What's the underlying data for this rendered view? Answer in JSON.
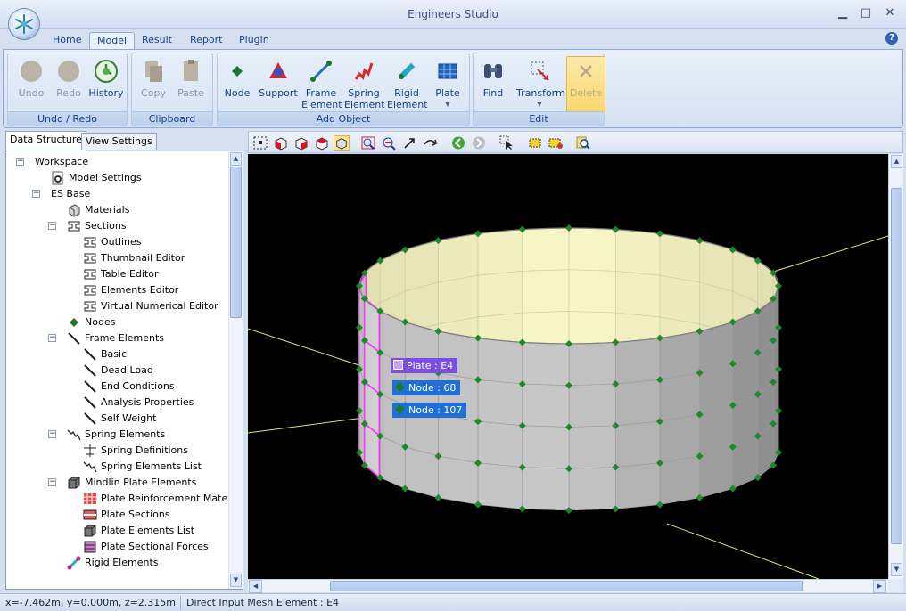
{
  "window": {
    "title": "Engineers Studio",
    "controls": {
      "minimize": "▁",
      "maximize": "□",
      "close": "✕"
    }
  },
  "ribbon": {
    "tabs": [
      "Home",
      "Model",
      "Result",
      "Report",
      "Plugin"
    ],
    "active_tab": "Model",
    "help": "?",
    "groups": [
      {
        "label": "Undo / Redo",
        "buttons": [
          "Undo",
          "Redo",
          "History"
        ]
      },
      {
        "label": "Clipboard",
        "buttons": [
          "Copy",
          "Paste"
        ]
      },
      {
        "label": "Add Object",
        "buttons": [
          "Node",
          "Support",
          "Frame\nElement",
          "Spring\nElement",
          "Rigid\nElement",
          "Plate"
        ]
      },
      {
        "label": "Edit",
        "buttons": [
          "Find",
          "Transform",
          "Delete"
        ]
      }
    ]
  },
  "left_panel": {
    "tabs": [
      "Data Structure",
      "View Settings"
    ],
    "active_tab": "Data Structure",
    "tree": [
      {
        "label": "Workspace",
        "level": 0,
        "icon": "none",
        "expander": "−"
      },
      {
        "label": "Model Settings",
        "level": 1,
        "icon": "settings-icon"
      },
      {
        "label": "ES Base",
        "level": 1,
        "icon": "none",
        "expander": "−"
      },
      {
        "label": "Materials",
        "level": 2,
        "icon": "materials-icon"
      },
      {
        "label": "Sections",
        "level": 2,
        "icon": "section-icon",
        "expander": "−"
      },
      {
        "label": "Outlines",
        "level": 3,
        "icon": "section-icon"
      },
      {
        "label": "Thumbnail Editor",
        "level": 3,
        "icon": "section-icon"
      },
      {
        "label": "Table Editor",
        "level": 3,
        "icon": "section-icon"
      },
      {
        "label": "Elements Editor",
        "level": 3,
        "icon": "section-icon"
      },
      {
        "label": "Virtual Numerical Editor",
        "level": 3,
        "icon": "section-icon"
      },
      {
        "label": "Nodes",
        "level": 2,
        "icon": "node-icon"
      },
      {
        "label": "Frame Elements",
        "level": 2,
        "icon": "frame-icon",
        "expander": "−"
      },
      {
        "label": "Basic",
        "level": 3,
        "icon": "frame-icon"
      },
      {
        "label": "Dead Load",
        "level": 3,
        "icon": "frame-icon"
      },
      {
        "label": "End Conditions",
        "level": 3,
        "icon": "frame-icon"
      },
      {
        "label": "Analysis Properties",
        "level": 3,
        "icon": "frame-icon"
      },
      {
        "label": "Self Weight",
        "level": 3,
        "icon": "frame-icon"
      },
      {
        "label": "Spring Elements",
        "level": 2,
        "icon": "spring-icon",
        "expander": "−"
      },
      {
        "label": "Spring Definitions",
        "level": 3,
        "icon": "spring-def-icon"
      },
      {
        "label": "Spring Elements List",
        "level": 3,
        "icon": "spring-icon"
      },
      {
        "label": "Mindlin Plate Elements",
        "level": 2,
        "icon": "plate-box-icon",
        "expander": "−"
      },
      {
        "label": "Plate Reinforcement Materials",
        "level": 3,
        "icon": "reinforcement-icon"
      },
      {
        "label": "Plate Sections",
        "level": 3,
        "icon": "plate-section-icon"
      },
      {
        "label": "Plate Elements List",
        "level": 3,
        "icon": "plate-box-icon"
      },
      {
        "label": "Plate Sectional Forces",
        "level": 3,
        "icon": "plate-forces-icon"
      },
      {
        "label": "Rigid Elements",
        "level": 2,
        "icon": "rigid-icon"
      }
    ]
  },
  "viewport": {
    "tooltips": [
      {
        "label": "Plate : E4",
        "color": "#7b4ee0"
      },
      {
        "label": "Node : 68",
        "color": "#1f6fd6"
      },
      {
        "label": "Node : 107",
        "color": "#1f6fd6"
      }
    ]
  },
  "statusbar": {
    "coordinates": "x=-7.462m, y=0.000m, z=2.315m",
    "mode": "Direct Input Mesh Element : E4"
  },
  "colors": {
    "accent": "#15428b",
    "selected_plate": "#ff33ff",
    "node": "#1d8a2a"
  }
}
